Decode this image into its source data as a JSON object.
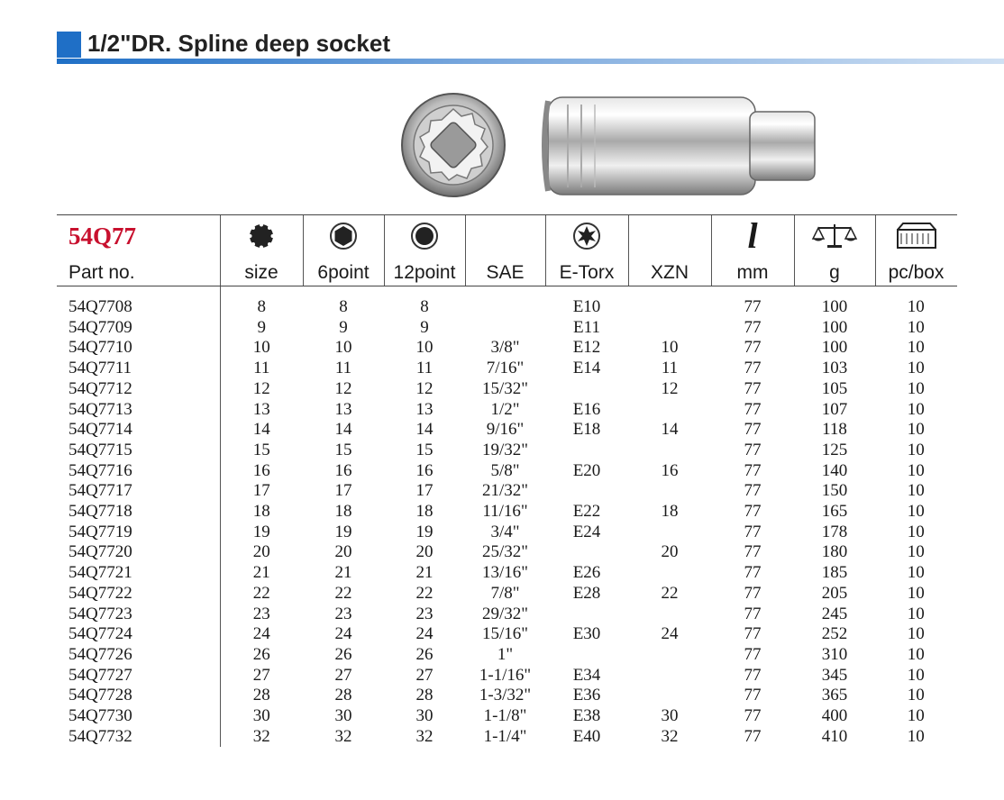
{
  "title": "1/2\"DR. Spline deep socket",
  "model_code": "54Q77",
  "headers": {
    "part": "Part no.",
    "size": "size",
    "six_point": "6point",
    "twelve_point": "12point",
    "sae": "SAE",
    "etorx": "E-Torx",
    "xzn": "XZN",
    "mm": "mm",
    "g": "g",
    "pcbox": "pc/box"
  },
  "icons": {
    "length_glyph": "l",
    "spline": "spline-socket-icon",
    "six_point": "hex-6point-icon",
    "twelve_point": "12point-icon",
    "etorx": "e-torx-icon",
    "length": "length-icon",
    "weight": "scale-icon",
    "box": "box-icon",
    "product": "spline-deep-socket-photo"
  },
  "colors": {
    "accent": "#1f6fc6",
    "model_code": "#c8102e"
  },
  "rows": [
    [
      "54Q7708",
      "8",
      "8",
      "8",
      "",
      "E10",
      "",
      "77",
      "100",
      "10"
    ],
    [
      "54Q7709",
      "9",
      "9",
      "9",
      "",
      "E11",
      "",
      "77",
      "100",
      "10"
    ],
    [
      "54Q7710",
      "10",
      "10",
      "10",
      "3/8\"",
      "E12",
      "10",
      "77",
      "100",
      "10"
    ],
    [
      "54Q7711",
      "11",
      "11",
      "11",
      "7/16\"",
      "E14",
      "11",
      "77",
      "103",
      "10"
    ],
    [
      "54Q7712",
      "12",
      "12",
      "12",
      "15/32\"",
      "",
      "12",
      "77",
      "105",
      "10"
    ],
    [
      "54Q7713",
      "13",
      "13",
      "13",
      "1/2\"",
      "E16",
      "",
      "77",
      "107",
      "10"
    ],
    [
      "54Q7714",
      "14",
      "14",
      "14",
      "9/16\"",
      "E18",
      "14",
      "77",
      "118",
      "10"
    ],
    [
      "54Q7715",
      "15",
      "15",
      "15",
      "19/32\"",
      "",
      "",
      "77",
      "125",
      "10"
    ],
    [
      "54Q7716",
      "16",
      "16",
      "16",
      "5/8\"",
      "E20",
      "16",
      "77",
      "140",
      "10"
    ],
    [
      "54Q7717",
      "17",
      "17",
      "17",
      "21/32\"",
      "",
      "",
      "77",
      "150",
      "10"
    ],
    [
      "54Q7718",
      "18",
      "18",
      "18",
      "11/16\"",
      "E22",
      "18",
      "77",
      "165",
      "10"
    ],
    [
      "54Q7719",
      "19",
      "19",
      "19",
      "3/4\"",
      "E24",
      "",
      "77",
      "178",
      "10"
    ],
    [
      "54Q7720",
      "20",
      "20",
      "20",
      "25/32\"",
      "",
      "20",
      "77",
      "180",
      "10"
    ],
    [
      "54Q7721",
      "21",
      "21",
      "21",
      "13/16\"",
      "E26",
      "",
      "77",
      "185",
      "10"
    ],
    [
      "54Q7722",
      "22",
      "22",
      "22",
      "7/8\"",
      "E28",
      "22",
      "77",
      "205",
      "10"
    ],
    [
      "54Q7723",
      "23",
      "23",
      "23",
      "29/32\"",
      "",
      "",
      "77",
      "245",
      "10"
    ],
    [
      "54Q7724",
      "24",
      "24",
      "24",
      "15/16\"",
      "E30",
      "24",
      "77",
      "252",
      "10"
    ],
    [
      "54Q7726",
      "26",
      "26",
      "26",
      "1\"",
      "",
      "",
      "77",
      "310",
      "10"
    ],
    [
      "54Q7727",
      "27",
      "27",
      "27",
      "1-1/16\"",
      "E34",
      "",
      "77",
      "345",
      "10"
    ],
    [
      "54Q7728",
      "28",
      "28",
      "28",
      "1-3/32\"",
      "E36",
      "",
      "77",
      "365",
      "10"
    ],
    [
      "54Q7730",
      "30",
      "30",
      "30",
      "1-1/8\"",
      "E38",
      "30",
      "77",
      "400",
      "10"
    ],
    [
      "54Q7732",
      "32",
      "32",
      "32",
      "1-1/4\"",
      "E40",
      "32",
      "77",
      "410",
      "10"
    ]
  ]
}
